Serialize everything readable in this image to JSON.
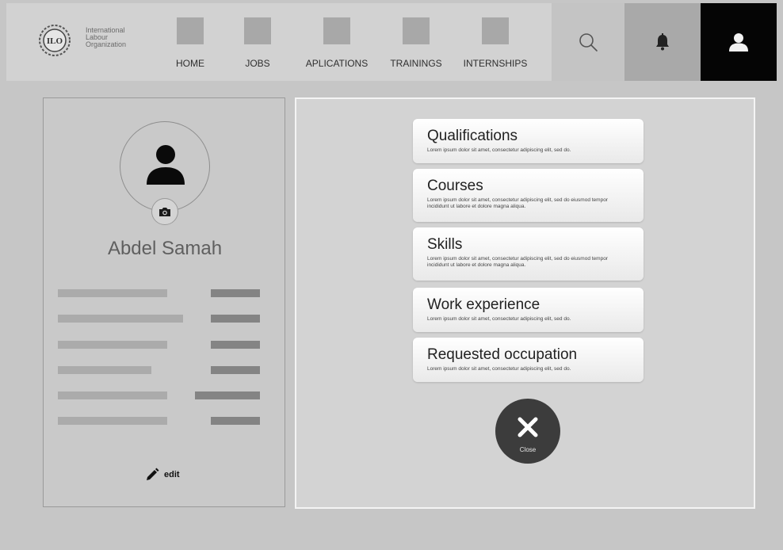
{
  "header": {
    "logo_text": [
      "International",
      "Labour",
      "Organization"
    ],
    "logo_mark": "ILO",
    "nav": [
      {
        "label": "HOME"
      },
      {
        "label": "JOBS"
      },
      {
        "label": "APLICATIONS"
      },
      {
        "label": "TRAININGS"
      },
      {
        "label": "INTERNSHIPS"
      }
    ],
    "icons": {
      "search": "search-icon",
      "bell": "bell-icon",
      "user": "user-icon"
    }
  },
  "profile": {
    "name": "Abdel Samah",
    "edit_label": "edit",
    "avatar_icon": "user-icon",
    "camera_icon": "camera-icon"
  },
  "panel": {
    "cards": [
      {
        "title": "Qualifications",
        "desc": "Lorem ipsum dolor sit amet, consectetur adipiscing elit, sed do."
      },
      {
        "title": "Courses",
        "desc": "Lorem ipsum dolor sit amet, consectetur adipiscing elit, sed do eiusmod tempor incididunt ut labore et dolore magna aliqua."
      },
      {
        "title": "Skills",
        "desc": "Lorem ipsum dolor sit amet, consectetur adipiscing elit, sed do eiusmod tempor incididunt ut labore et dolore magna aliqua."
      },
      {
        "title": "Work experience",
        "desc": "Lorem ipsum dolor sit amet, consectetur adipiscing elit, sed do."
      },
      {
        "title": "Requested occupation",
        "desc": "Lorem ipsum dolor sit amet, consectetur adipiscing elit, sed do."
      }
    ],
    "close_label": "Close"
  },
  "colors": {
    "background": "#c6c6c6",
    "header": "#d2d2d2",
    "user_button": "#050505",
    "close_button": "#3c3c3c"
  }
}
